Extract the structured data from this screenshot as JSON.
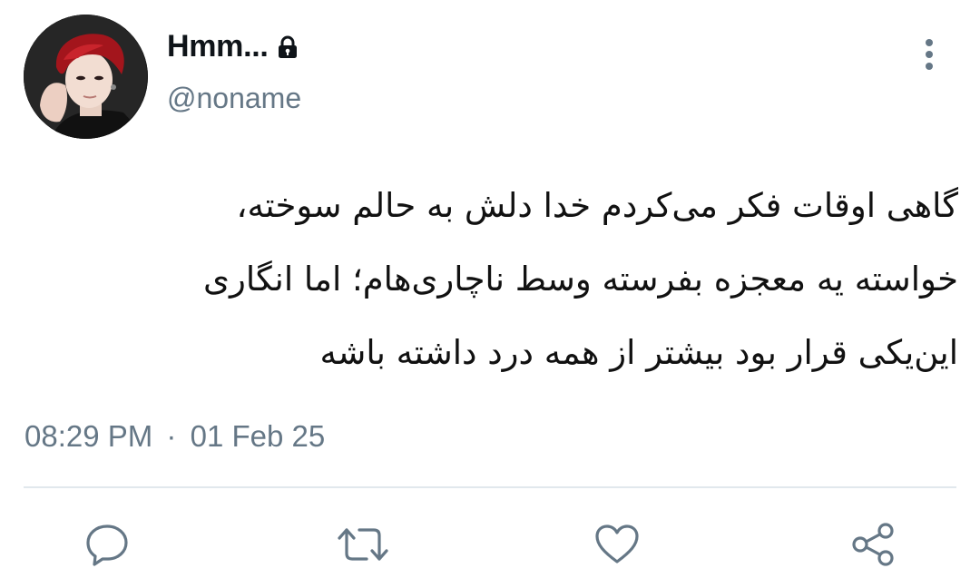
{
  "user": {
    "display_name": "Hmm...",
    "handle": "@noname",
    "locked_icon": "lock-icon",
    "avatar_icon": "avatar-photo"
  },
  "tweet": {
    "lines": [
      "گاهی اوقات فکر می‌کردم خدا دلش به حالم سوخته،",
      "خواسته یه معجزه بفرسته وسط ناچاری‌هام؛ اما انگاری",
      "این‌یکی قرار بود بیشتر از همه درد داشته باشه"
    ]
  },
  "meta": {
    "time": "08:29 PM",
    "separator": "·",
    "date": "01 Feb 25"
  },
  "actions": [
    {
      "icon": "reply-icon"
    },
    {
      "icon": "retweet-icon"
    },
    {
      "icon": "like-icon"
    },
    {
      "icon": "share-icon"
    }
  ],
  "menu": {
    "icon": "more-vertical-icon"
  },
  "colors": {
    "primary_text": "#0f1419",
    "secondary_text": "#657786",
    "divider": "#e1e8ed"
  }
}
